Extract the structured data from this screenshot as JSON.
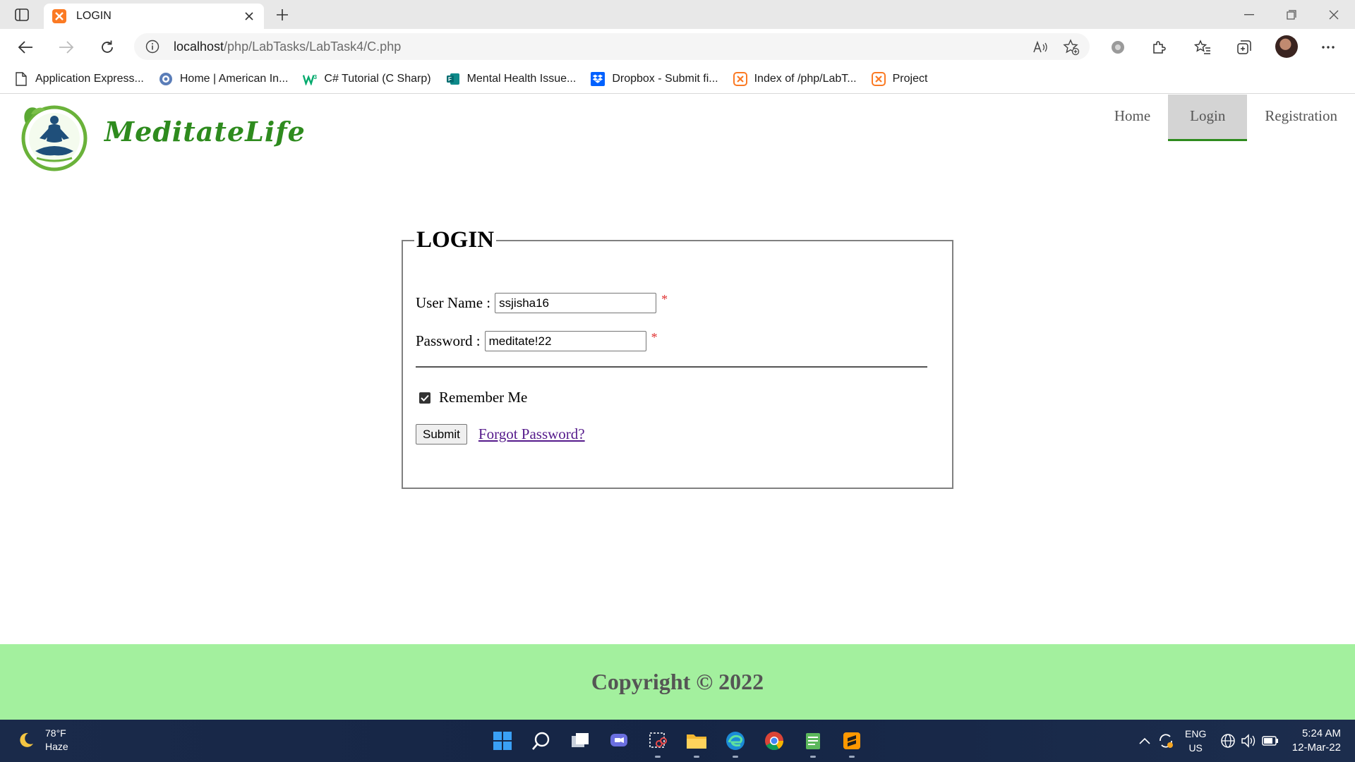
{
  "browser": {
    "tab_title": "LOGIN",
    "url_host": "localhost",
    "url_path": "/php/LabTasks/LabTask4/C.php",
    "bookmarks": [
      {
        "label": "Application Express...",
        "icon": "page-icon"
      },
      {
        "label": "Home | American In...",
        "icon": "globe-icon"
      },
      {
        "label": "C# Tutorial (C Sharp)",
        "icon": "w3schools-icon"
      },
      {
        "label": "Mental Health Issue...",
        "icon": "forms-icon"
      },
      {
        "label": "Dropbox - Submit fi...",
        "icon": "dropbox-icon"
      },
      {
        "label": "Index of /php/LabT...",
        "icon": "xampp-icon"
      },
      {
        "label": "Project",
        "icon": "xampp-icon"
      }
    ]
  },
  "site": {
    "brand": "MeditateLife",
    "nav": [
      {
        "label": "Home",
        "active": false
      },
      {
        "label": "Login",
        "active": true
      },
      {
        "label": "Registration",
        "active": false
      }
    ]
  },
  "login_form": {
    "legend": "LOGIN",
    "username_label": "User Name :",
    "username_value": "ssjisha16",
    "password_label": "Password :",
    "password_value": "meditate!22",
    "required_marker": "*",
    "remember_label": "Remember Me",
    "remember_checked": true,
    "submit_label": "Submit",
    "forgot_label": "Forgot Password?"
  },
  "footer": {
    "copyright": "Copyright © 2022"
  },
  "taskbar": {
    "weather_temp": "78°F",
    "weather_desc": "Haze",
    "lang_line1": "ENG",
    "lang_line2": "US",
    "time": "5:24 AM",
    "date": "12-Mar-22"
  },
  "colors": {
    "brand_green": "#2e8b1e",
    "footer_bg": "#a3f09e",
    "active_nav_bg": "#d4d4d4",
    "taskbar_bg": "#1a2a4a",
    "required_red": "#e03030"
  }
}
